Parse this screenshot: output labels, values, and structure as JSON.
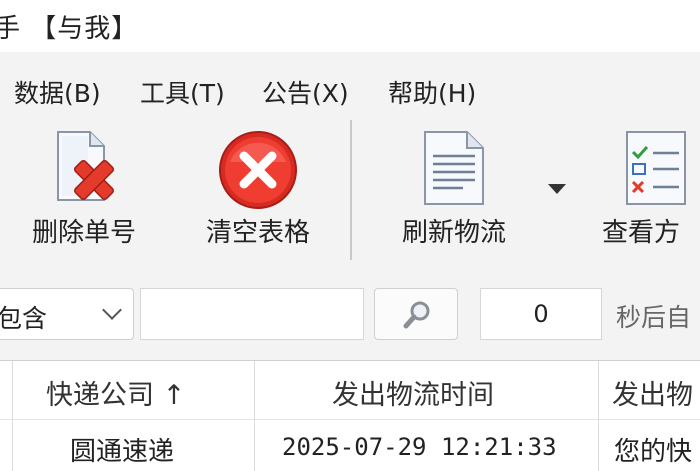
{
  "window": {
    "title": "手 【与我】"
  },
  "menu": [
    {
      "label": "数据(B)"
    },
    {
      "label": "工具(T)"
    },
    {
      "label": "公告(X)"
    },
    {
      "label": "帮助(H)"
    }
  ],
  "toolbar": {
    "buttons": [
      {
        "label": "删除单号",
        "icon": "delete-document-icon"
      },
      {
        "label": "清空表格",
        "icon": "clear-red-x-icon"
      },
      {
        "label": "刷新物流",
        "icon": "refresh-document-icon"
      },
      {
        "label": "查看方",
        "icon": "checklist-icon"
      }
    ]
  },
  "filter": {
    "select_value": "包含",
    "search_value": "",
    "search_icon": "search-icon",
    "seconds_value": "0",
    "seconds_label": "秒后自"
  },
  "table": {
    "columns": [
      "快递公司 ↑",
      "发出物流时间",
      "发出物"
    ],
    "rows": [
      {
        "company": "圆通速递",
        "time": "2025-07-29 12:21:33",
        "info": "您的快"
      }
    ]
  },
  "colors": {
    "accent_red": "#e8312c",
    "background": "#f3f3f3"
  }
}
